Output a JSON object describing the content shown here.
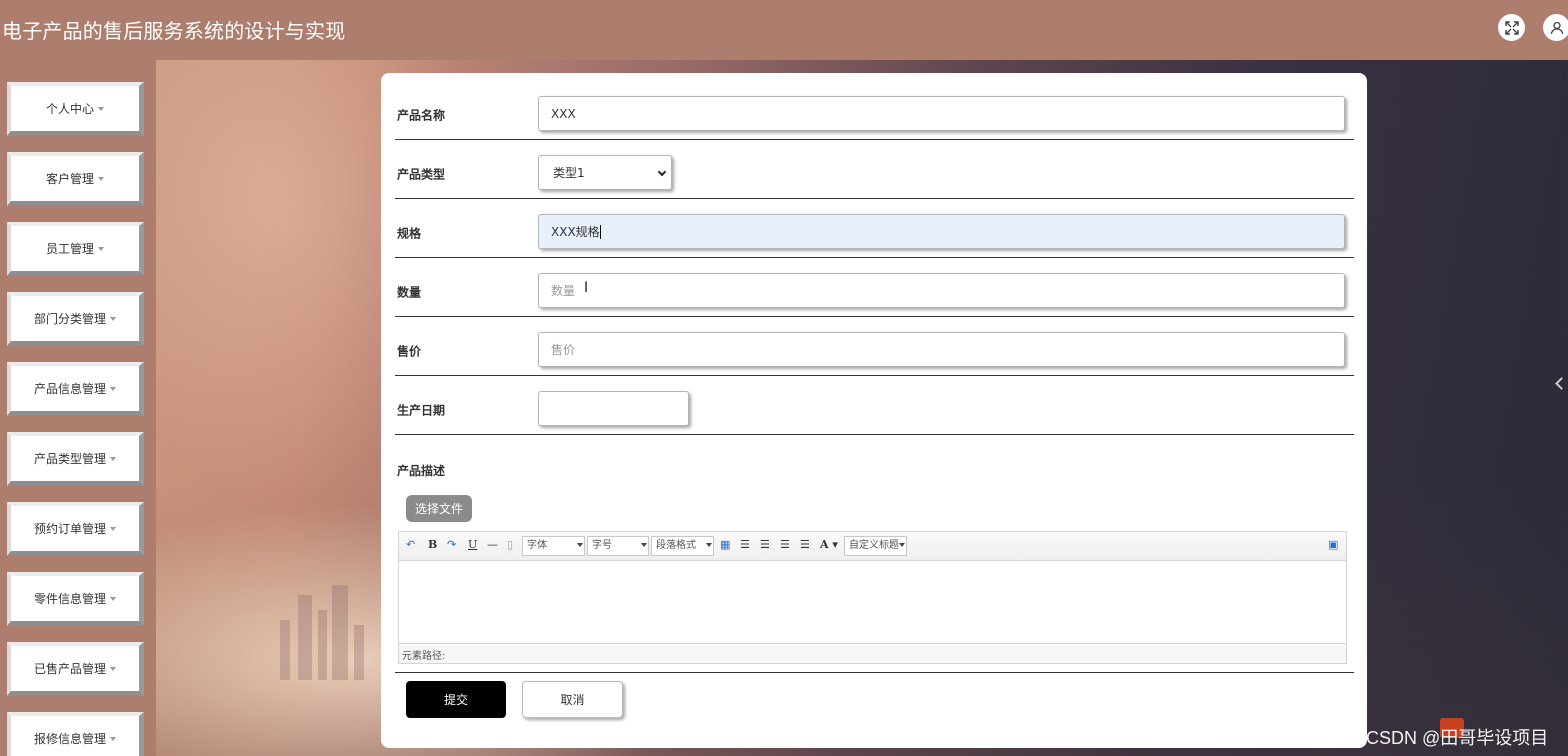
{
  "header": {
    "title": "电子产品的售后服务系统的设计与实现"
  },
  "sidebar": {
    "items": [
      {
        "label": "个人中心"
      },
      {
        "label": "客户管理"
      },
      {
        "label": "员工管理"
      },
      {
        "label": "部门分类管理"
      },
      {
        "label": "产品信息管理"
      },
      {
        "label": "产品类型管理"
      },
      {
        "label": "预约订单管理"
      },
      {
        "label": "零件信息管理"
      },
      {
        "label": "已售产品管理"
      },
      {
        "label": "报修信息管理"
      }
    ]
  },
  "form": {
    "name": {
      "label": "产品名称",
      "value": "XXX"
    },
    "type": {
      "label": "产品类型",
      "value": "类型1"
    },
    "spec": {
      "label": "规格",
      "value": "XXX规格"
    },
    "quantity": {
      "label": "数量",
      "placeholder": "数量"
    },
    "price": {
      "label": "售价",
      "placeholder": "售价"
    },
    "date": {
      "label": "生产日期",
      "value": ""
    },
    "description": {
      "label": "产品描述"
    },
    "upload_label": "选择文件",
    "editor": {
      "font_family": "字体",
      "font_size": "字号",
      "paragraph": "段落格式",
      "custom_title": "自定义标题",
      "status_label": "元素路径:"
    },
    "submit_label": "提交",
    "cancel_label": "取消"
  },
  "watermark": "CSDN @田哥毕设项目"
}
